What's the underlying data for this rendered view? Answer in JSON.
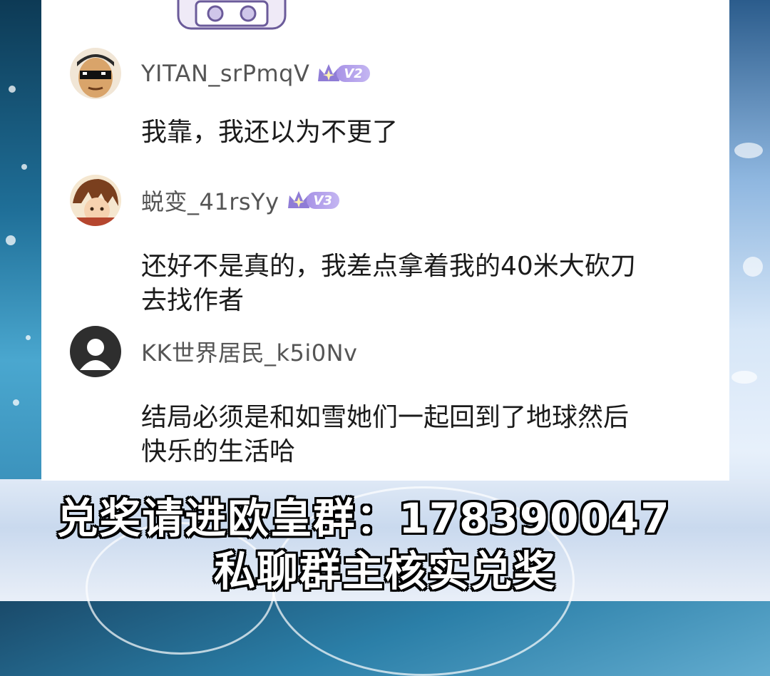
{
  "comments": [
    {
      "username": "YITAN_srPmqV",
      "level": "V2",
      "text_lines": [
        "我靠，我还以为不更了"
      ]
    },
    {
      "username": "蜕变_41rsYy",
      "level": "V3",
      "text_lines": [
        "还好不是真的，我差点拿着我的40米大砍刀",
        "去找作者"
      ]
    },
    {
      "username": "KK世界居民_k5i0Nv",
      "level": "",
      "text_lines": [
        "结局必须是和如雪她们一起回到了地球然后",
        "快乐的生活哈"
      ]
    }
  ],
  "banner": {
    "line1": "兑奖请进欧皇群：178390047",
    "line2": "私聊群主核实兑奖"
  },
  "colors": {
    "badge": "#a893e6",
    "username": "#555555",
    "comment_text": "#1b1b1b",
    "banner_text": "#ffffff"
  },
  "icons": [
    "crown-level-icon",
    "default-avatar-icon"
  ]
}
